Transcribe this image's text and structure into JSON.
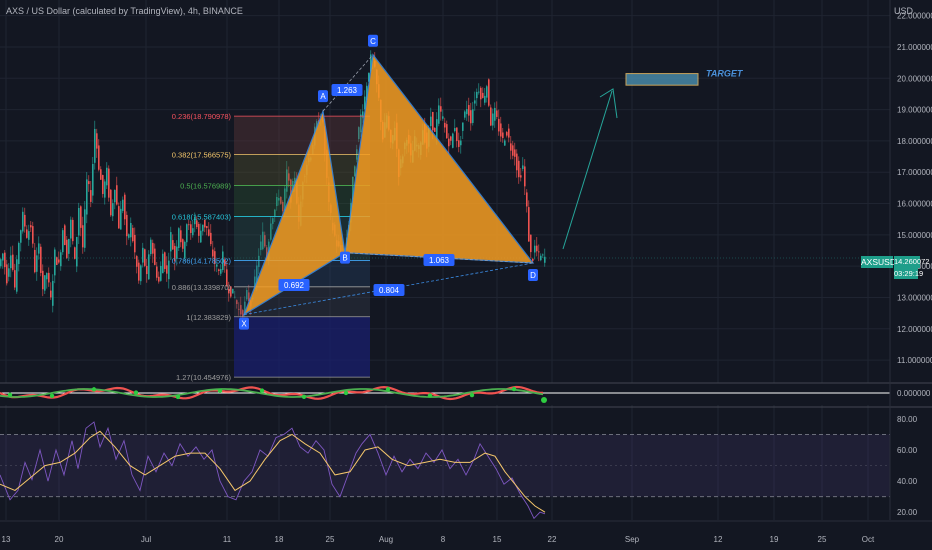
{
  "header": {
    "title": "AXS / US Dollar (calculated by TradingView), 4h, BINANCE",
    "currency": "USD"
  },
  "price_tag": {
    "symbol": "AXSUSD",
    "price": "14.260072",
    "countdown": "03:29:19"
  },
  "colors": {
    "up": "#26a69a",
    "down": "#ef5350",
    "pattern": "#f59d22",
    "pattern_edge": "#3c8de6",
    "label": "#2962ff",
    "rsi": "#7e57c2",
    "rsi_ma": "#f5c76b",
    "target": "#4a90d9"
  },
  "chart_data": [
    {
      "type": "candlestick",
      "symbol": "AXSUSD",
      "timeframe": "4h",
      "ylim": [
        10.3,
        22.5
      ],
      "yticks": [
        "22.000000",
        "21.000000",
        "20.000000",
        "19.000000",
        "18.000000",
        "17.000000",
        "16.000000",
        "15.000000",
        "14.000000",
        "13.000000",
        "12.000000",
        "11.000000"
      ],
      "xticks": [
        "13",
        "20",
        "Jul",
        "11",
        "18",
        "25",
        "Aug",
        "8",
        "15",
        "22",
        "Sep",
        "12",
        "19",
        "25",
        "Oct"
      ],
      "price_path": [
        [
          0,
          14.0
        ],
        [
          4,
          14.4
        ],
        [
          8,
          13.6
        ],
        [
          12,
          14.5
        ],
        [
          16,
          13.3
        ],
        [
          20,
          14.8
        ],
        [
          24,
          15.6
        ],
        [
          28,
          15.0
        ],
        [
          32,
          15.3
        ],
        [
          36,
          13.9
        ],
        [
          40,
          14.6
        ],
        [
          44,
          13.3
        ],
        [
          48,
          13.8
        ],
        [
          52,
          12.9
        ],
        [
          56,
          14.4
        ],
        [
          60,
          14.0
        ],
        [
          64,
          15.2
        ],
        [
          68,
          14.4
        ],
        [
          72,
          15.4
        ],
        [
          76,
          14.1
        ],
        [
          80,
          15.9
        ],
        [
          84,
          14.6
        ],
        [
          88,
          16.7
        ],
        [
          92,
          16.2
        ],
        [
          96,
          18.4
        ],
        [
          100,
          17.2
        ],
        [
          104,
          16.3
        ],
        [
          108,
          17.0
        ],
        [
          112,
          15.6
        ],
        [
          116,
          16.6
        ],
        [
          120,
          15.3
        ],
        [
          124,
          16.2
        ],
        [
          128,
          14.8
        ],
        [
          132,
          15.3
        ],
        [
          136,
          14.4
        ],
        [
          140,
          13.5
        ],
        [
          144,
          14.5
        ],
        [
          148,
          13.6
        ],
        [
          152,
          14.9
        ],
        [
          156,
          14.0
        ],
        [
          160,
          13.5
        ],
        [
          164,
          14.4
        ],
        [
          168,
          13.7
        ],
        [
          172,
          15.0
        ],
        [
          176,
          14.2
        ],
        [
          180,
          15.3
        ],
        [
          184,
          14.4
        ],
        [
          188,
          15.4
        ],
        [
          192,
          15.0
        ],
        [
          196,
          15.6
        ],
        [
          200,
          14.9
        ],
        [
          204,
          15.4
        ],
        [
          208,
          15.2
        ],
        [
          212,
          14.6
        ],
        [
          216,
          14.1
        ],
        [
          220,
          13.8
        ],
        [
          224,
          14.3
        ],
        [
          228,
          13.4
        ],
        [
          232,
          13.2
        ],
        [
          236,
          13.0
        ],
        [
          240,
          12.6
        ],
        [
          244,
          12.45
        ],
        [
          248,
          13.1
        ],
        [
          252,
          12.8
        ],
        [
          256,
          13.5
        ],
        [
          260,
          14.4
        ],
        [
          264,
          15.0
        ],
        [
          268,
          14.3
        ],
        [
          272,
          15.5
        ],
        [
          276,
          15.8
        ],
        [
          280,
          16.3
        ],
        [
          284,
          15.7
        ],
        [
          288,
          17.0
        ],
        [
          292,
          16.2
        ],
        [
          296,
          16.9
        ],
        [
          300,
          15.3
        ],
        [
          304,
          16.8
        ],
        [
          308,
          17.3
        ],
        [
          312,
          17.6
        ],
        [
          316,
          18.3
        ],
        [
          320,
          18.7
        ],
        [
          323,
          18.9
        ],
        [
          326,
          17.6
        ],
        [
          330,
          15.9
        ],
        [
          334,
          15.2
        ],
        [
          338,
          14.7
        ],
        [
          342,
          14.4
        ],
        [
          346,
          14.5
        ],
        [
          350,
          15.4
        ],
        [
          354,
          16.7
        ],
        [
          358,
          17.9
        ],
        [
          362,
          18.8
        ],
        [
          366,
          19.4
        ],
        [
          370,
          20.3
        ],
        [
          373,
          20.75
        ],
        [
          376,
          20.2
        ],
        [
          380,
          19.3
        ],
        [
          384,
          18.1
        ],
        [
          388,
          18.8
        ],
        [
          392,
          17.8
        ],
        [
          396,
          18.5
        ],
        [
          400,
          17.0
        ],
        [
          404,
          17.6
        ],
        [
          408,
          18.2
        ],
        [
          412,
          17.4
        ],
        [
          416,
          18.0
        ],
        [
          420,
          17.7
        ],
        [
          424,
          18.4
        ],
        [
          428,
          17.8
        ],
        [
          432,
          18.8
        ],
        [
          436,
          18.2
        ],
        [
          440,
          19.0
        ],
        [
          444,
          18.7
        ],
        [
          448,
          18.1
        ],
        [
          452,
          17.9
        ],
        [
          456,
          18.5
        ],
        [
          460,
          17.7
        ],
        [
          464,
          18.6
        ],
        [
          468,
          19.1
        ],
        [
          472,
          18.7
        ],
        [
          476,
          19.4
        ],
        [
          480,
          19.7
        ],
        [
          484,
          19.3
        ],
        [
          488,
          19.8
        ],
        [
          492,
          18.6
        ],
        [
          496,
          18.9
        ],
        [
          500,
          18.4
        ],
        [
          504,
          18.0
        ],
        [
          508,
          18.3
        ],
        [
          512,
          17.8
        ],
        [
          516,
          17.6
        ],
        [
          520,
          16.8
        ],
        [
          524,
          17.2
        ],
        [
          528,
          15.8
        ],
        [
          530,
          14.9
        ],
        [
          533,
          14.1
        ],
        [
          536,
          14.6
        ],
        [
          540,
          14.3
        ],
        [
          544,
          14.26
        ]
      ],
      "harmonic_pattern": {
        "points": {
          "X": "X",
          "A": "A",
          "B": "B",
          "C": "C",
          "D": "D"
        },
        "prices": {
          "X": 12.45,
          "A": 18.95,
          "B": 14.43,
          "C": 20.75,
          "D": 14.1
        },
        "ratios": {
          "xab": "0.692",
          "abc": "1.263",
          "bcd": "1.063",
          "xad": "0.804"
        }
      },
      "fibonacci_levels": [
        {
          "label": "0.236(18.790978)",
          "price": 18.790978,
          "color": "#f7525f"
        },
        {
          "label": "0.382(17.566575)",
          "price": 17.566575,
          "color": "#f5c76b"
        },
        {
          "label": "0.5(16.576989)",
          "price": 16.576989,
          "color": "#4caf50"
        },
        {
          "label": "0.618(15.587403)",
          "price": 15.587403,
          "color": "#26c6da"
        },
        {
          "label": "0.786(14.178502)",
          "price": 14.178502,
          "color": "#42a5f5"
        },
        {
          "label": "0.886(13.339870)",
          "price": 13.33987,
          "color": "#9e9e9e"
        },
        {
          "label": "1(12.383829)",
          "price": 12.383829,
          "color": "#9e9e9e"
        },
        {
          "label": "1.27(10.454976)",
          "price": 10.454976,
          "color": "#9e9e9e"
        }
      ],
      "target": {
        "label": "TARGET",
        "price_low": 19.78,
        "price_high": 20.15
      }
    },
    {
      "type": "line",
      "name": "",
      "zero_label": "0.000000"
    },
    {
      "type": "line",
      "ylim": [
        15,
        87
      ],
      "yticks": [
        "80.00",
        "60.00",
        "40.00",
        "20.00"
      ],
      "bands": [
        70,
        30
      ],
      "rsi": [
        [
          0,
          44
        ],
        [
          10,
          28
        ],
        [
          18,
          34
        ],
        [
          25,
          52
        ],
        [
          32,
          41
        ],
        [
          40,
          60
        ],
        [
          48,
          40
        ],
        [
          56,
          60
        ],
        [
          64,
          44
        ],
        [
          72,
          66
        ],
        [
          78,
          48
        ],
        [
          86,
          74
        ],
        [
          94,
          78
        ],
        [
          100,
          62
        ],
        [
          108,
          74
        ],
        [
          116,
          54
        ],
        [
          124,
          66
        ],
        [
          132,
          44
        ],
        [
          140,
          34
        ],
        [
          148,
          56
        ],
        [
          156,
          46
        ],
        [
          164,
          58
        ],
        [
          172,
          50
        ],
        [
          180,
          64
        ],
        [
          188,
          56
        ],
        [
          196,
          62
        ],
        [
          204,
          54
        ],
        [
          212,
          60
        ],
        [
          220,
          40
        ],
        [
          228,
          30
        ],
        [
          236,
          28
        ],
        [
          244,
          40
        ],
        [
          252,
          46
        ],
        [
          260,
          60
        ],
        [
          268,
          56
        ],
        [
          276,
          68
        ],
        [
          284,
          70
        ],
        [
          292,
          74
        ],
        [
          300,
          62
        ],
        [
          308,
          58
        ],
        [
          316,
          66
        ],
        [
          324,
          60
        ],
        [
          332,
          38
        ],
        [
          340,
          30
        ],
        [
          348,
          44
        ],
        [
          356,
          58
        ],
        [
          362,
          64
        ],
        [
          370,
          70
        ],
        [
          378,
          58
        ],
        [
          386,
          44
        ],
        [
          394,
          56
        ],
        [
          402,
          46
        ],
        [
          410,
          54
        ],
        [
          418,
          48
        ],
        [
          426,
          58
        ],
        [
          434,
          52
        ],
        [
          442,
          60
        ],
        [
          450,
          48
        ],
        [
          458,
          54
        ],
        [
          466,
          44
        ],
        [
          474,
          54
        ],
        [
          480,
          64
        ],
        [
          488,
          56
        ],
        [
          496,
          48
        ],
        [
          504,
          38
        ],
        [
          512,
          42
        ],
        [
          520,
          32
        ],
        [
          528,
          24
        ],
        [
          534,
          16
        ],
        [
          540,
          20
        ],
        [
          545,
          19
        ]
      ],
      "rsi_ma": [
        [
          0,
          38
        ],
        [
          15,
          34
        ],
        [
          30,
          42
        ],
        [
          45,
          50
        ],
        [
          60,
          52
        ],
        [
          75,
          58
        ],
        [
          90,
          68
        ],
        [
          100,
          72
        ],
        [
          115,
          62
        ],
        [
          130,
          50
        ],
        [
          145,
          44
        ],
        [
          160,
          50
        ],
        [
          175,
          56
        ],
        [
          190,
          58
        ],
        [
          205,
          58
        ],
        [
          220,
          48
        ],
        [
          235,
          34
        ],
        [
          250,
          40
        ],
        [
          265,
          54
        ],
        [
          280,
          66
        ],
        [
          292,
          70
        ],
        [
          305,
          64
        ],
        [
          320,
          58
        ],
        [
          335,
          44
        ],
        [
          350,
          46
        ],
        [
          365,
          60
        ],
        [
          378,
          62
        ],
        [
          392,
          54
        ],
        [
          408,
          50
        ],
        [
          425,
          52
        ],
        [
          440,
          54
        ],
        [
          455,
          52
        ],
        [
          470,
          52
        ],
        [
          485,
          58
        ],
        [
          495,
          56
        ],
        [
          505,
          46
        ],
        [
          515,
          38
        ],
        [
          525,
          30
        ],
        [
          535,
          24
        ],
        [
          545,
          20
        ]
      ]
    }
  ]
}
